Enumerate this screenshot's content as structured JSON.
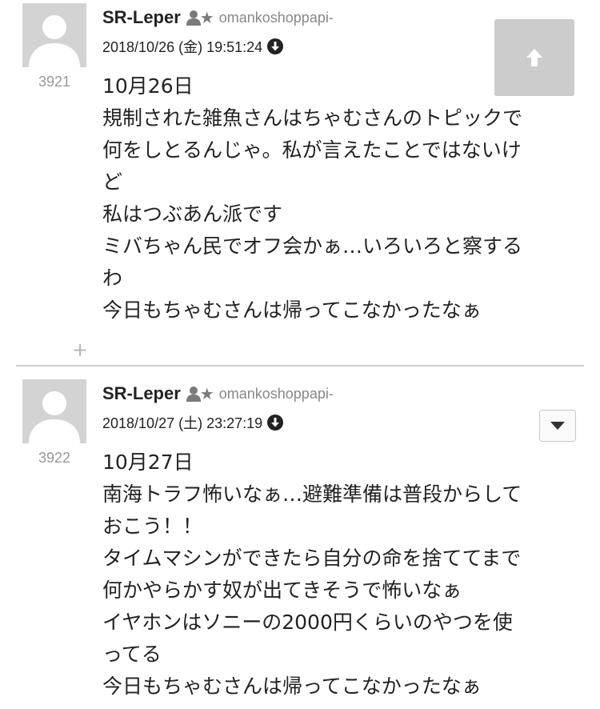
{
  "posts": [
    {
      "number": "3921",
      "username": "SR-Leper",
      "user_id": "omankoshoppapi-",
      "datetime": "2018/10/26 (金) 19:51:24",
      "lines": [
        "10月26日",
        "規制された雑魚さんはちゃむさんのトピックで",
        "何をしとるんじゃ。私が言えたことではないけ",
        "ど",
        "私はつぶあん派です",
        "ミバちゃん民でオフ会かぁ…いろいろと察する",
        "わ",
        "今日もちゃむさんは帰ってこなかったなぁ"
      ]
    },
    {
      "number": "3922",
      "username": "SR-Leper",
      "user_id": "omankoshoppapi-",
      "datetime": "2018/10/27 (土) 23:27:19",
      "lines": [
        "10月27日",
        "南海トラフ怖いなぁ…避難準備は普段からして",
        "おこう！！",
        "タイムマシンができたら自分の命を捨ててまで",
        "何かやらかす奴が出てきそうで怖いなぁ",
        "イヤホンはソニーの2000円くらいのやつを使",
        "ってる",
        "今日もちゃむさんは帰ってこなかったなぁ"
      ]
    }
  ],
  "controls": {
    "plus_symbol": "+",
    "scroll_top_icon": "arrow-up-icon",
    "menu_icon": "caret-down-icon"
  },
  "colors": {
    "avatar_bg": "#d3d3d3",
    "scroll_button_bg": "#cccccc",
    "post_number": "#999999",
    "user_id": "#888888",
    "text": "#222222"
  }
}
